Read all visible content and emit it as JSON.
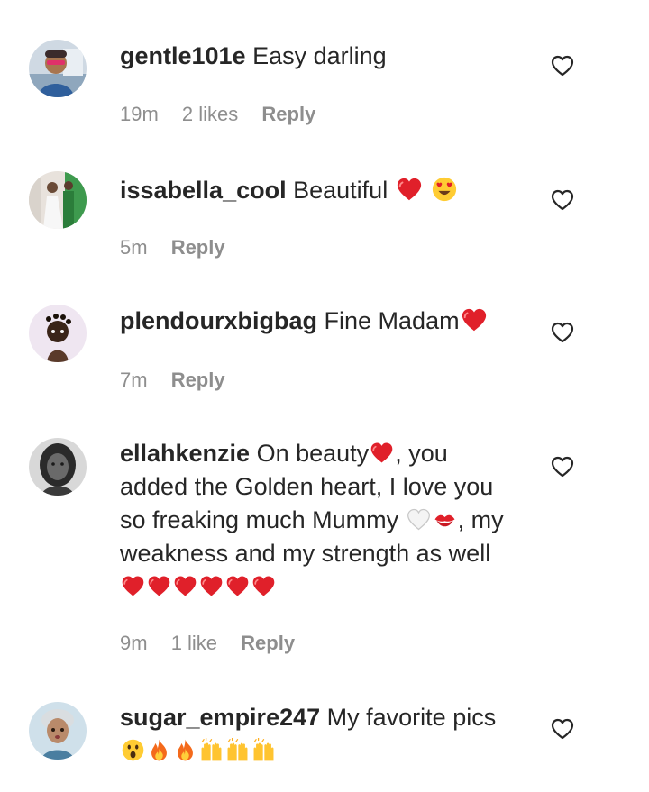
{
  "comments": [
    {
      "username": "gentle101e",
      "text": "Easy darling",
      "time": "19m",
      "likes": "2 likes",
      "reply": "Reply"
    },
    {
      "username": "issabella_cool",
      "text": "Beautiful",
      "time": "5m",
      "reply": "Reply"
    },
    {
      "username": "plendourxbigbag",
      "text": "Fine Madam",
      "time": "7m",
      "reply": "Reply"
    },
    {
      "username": "ellahkenzie",
      "text_parts": [
        "On beauty",
        ", you added the Golden heart, I love you so freaking much Mummy ",
        ", my weakness and my strength as well"
      ],
      "time": "9m",
      "likes": "1 like",
      "reply": "Reply"
    },
    {
      "username": "sugar_empire247",
      "text": "My favorite pics"
    }
  ],
  "icons": {
    "like": "heart-outline-icon",
    "red_heart": "red-heart-emoji",
    "heart_eyes": "heart-eyes-emoji",
    "white_heart": "white-heart-emoji",
    "kiss": "kiss-mark-emoji",
    "surprised": "surprised-face-emoji",
    "fire": "fire-emoji",
    "raised_hands": "raised-hands-emoji"
  },
  "colors": {
    "text": "#262626",
    "meta": "#8e8e8e",
    "red_heart": "#e0202a"
  }
}
